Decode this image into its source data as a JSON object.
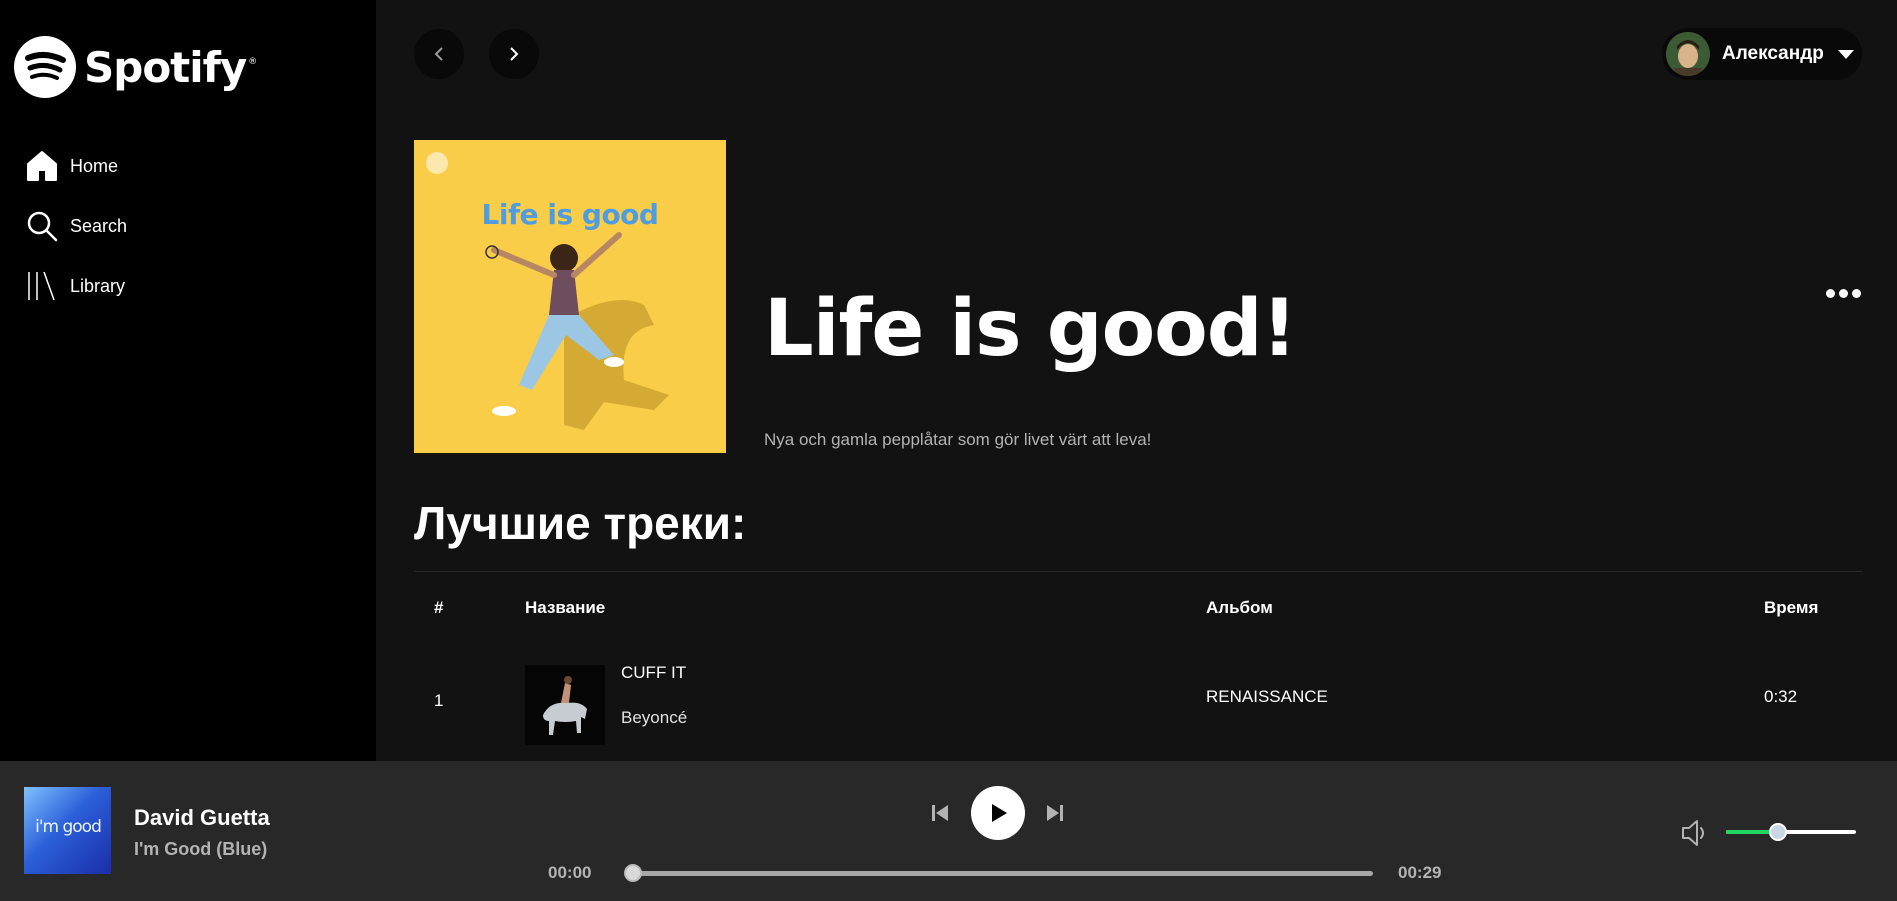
{
  "sidebar": {
    "logo_text": "Spotify",
    "logo_mark": "®",
    "items": [
      {
        "label": "Home",
        "icon": "home-icon"
      },
      {
        "label": "Search",
        "icon": "search-icon"
      },
      {
        "label": "Library",
        "icon": "library-icon"
      }
    ]
  },
  "header": {
    "user_name": "Александр"
  },
  "playlist": {
    "cover_text": "Life is good",
    "title": "Life is good!",
    "description": "Nya och gamla pepplåtar som gör livet värt att leva!"
  },
  "tracks": {
    "section_title": "Лучшие треки:",
    "columns": [
      "#",
      "Название",
      "Альбом",
      "Время"
    ],
    "rows": [
      {
        "num": "1",
        "title": "CUFF IT",
        "artist": "Beyoncé",
        "album": "RENAISSANCE",
        "time": "0:32"
      }
    ]
  },
  "player": {
    "cover_text": "i'm good",
    "artist": "David Guetta",
    "track": "I'm Good (Blue)",
    "time_current": "00:00",
    "time_total": "00:29",
    "progress": 0.0,
    "volume": 0.4
  },
  "colors": {
    "accent": "#1ed760",
    "background": "#121212",
    "sidebar": "#000000",
    "player_bar": "#282828"
  }
}
